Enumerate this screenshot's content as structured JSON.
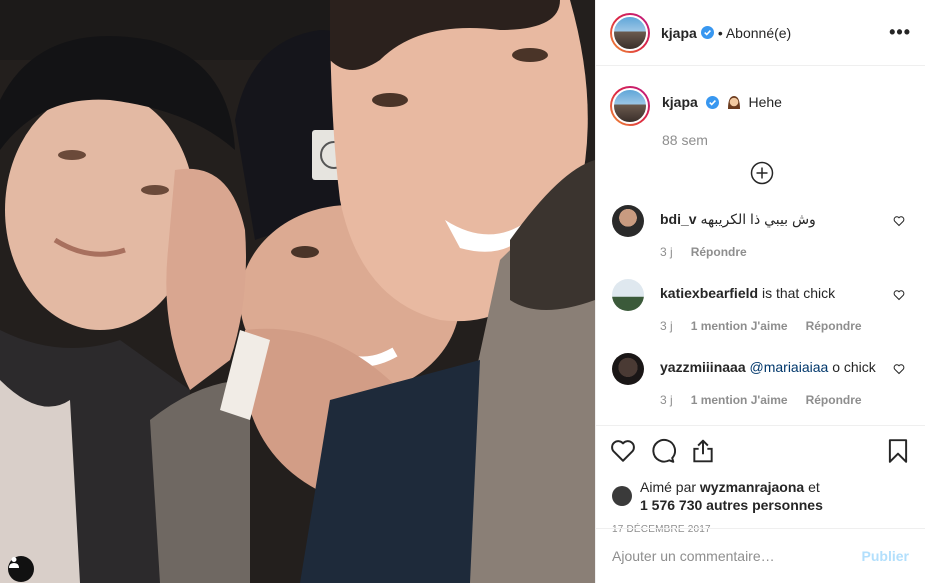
{
  "post": {
    "username": "kjapa",
    "follow_state": "Abonné(e)",
    "more_label": "•••",
    "caption_text": "Hehe",
    "caption_time": "88 sem",
    "date": "17 DÉCEMBRE 2017"
  },
  "comments": [
    {
      "username": "bdi_v",
      "text": "وش بيبي ذا الكريبهه",
      "mention": "",
      "time": "3 j",
      "likes": "",
      "reply": "Répondre"
    },
    {
      "username": "katiexbearfield",
      "text": "is that chick",
      "mention": "",
      "time": "3 j",
      "likes": "1 mention J'aime",
      "reply": "Répondre"
    },
    {
      "username": "yazzmiiinaaa",
      "text": "o chick",
      "mention": "@mariaiaiaa",
      "time": "3 j",
      "likes": "1 mention J'aime",
      "reply": "Répondre"
    }
  ],
  "likes": {
    "prefix": "Aimé par",
    "liker": "wyzmanrajaona",
    "suffix": "et",
    "others": "1 576 730 autres personnes"
  },
  "comment_box": {
    "placeholder": "Ajouter un commentaire…",
    "publish_label": "Publier"
  },
  "icons": [
    "user-tag-icon",
    "verified-icon",
    "more-icon",
    "load-more-icon",
    "heart-icon",
    "comment-icon",
    "share-icon",
    "bookmark-icon"
  ],
  "colors": {
    "verified": "#3897f0",
    "link": "#00376b",
    "muted": "#8e8e8e",
    "publish_disabled": "#b2dffc"
  }
}
